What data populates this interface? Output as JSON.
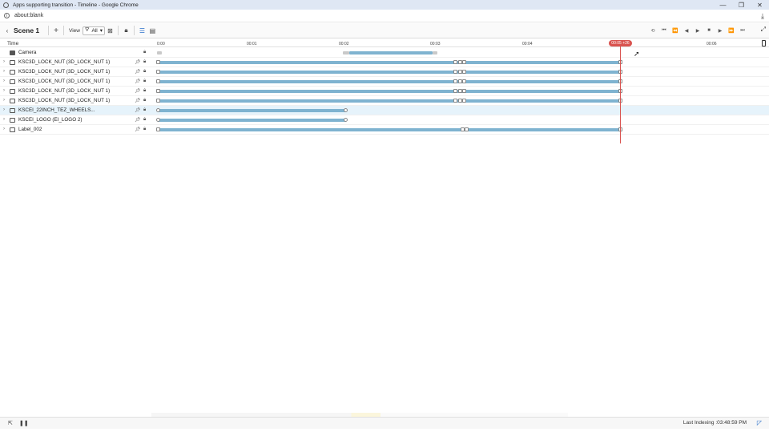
{
  "window": {
    "title": "Apps supporting transition - Timeline - Google Chrome",
    "controls": [
      "—",
      "❐",
      "✕"
    ]
  },
  "addressbar": {
    "url": "about:blank"
  },
  "toolbar": {
    "scene_title": "Scene 1",
    "view_label": "View",
    "filter_value": "All"
  },
  "timeline": {
    "header_label": "Time",
    "ticks": [
      "0:00",
      "00:01",
      "00:02",
      "00:03",
      "00:04",
      "00:06"
    ],
    "playhead_time": "00:05 +26"
  },
  "tracks": [
    {
      "name": "Camera",
      "icon": "camera-icon",
      "pinned": false
    },
    {
      "name": "KSC3D_LOCK_NUT (3D_LOCK_NUT 1)",
      "icon": "object-3d-icon",
      "pinned": true
    },
    {
      "name": "KSC3D_LOCK_NUT (3D_LOCK_NUT 1)",
      "icon": "object-3d-icon",
      "pinned": true
    },
    {
      "name": "KSC3D_LOCK_NUT (3D_LOCK_NUT 1)",
      "icon": "object-3d-icon",
      "pinned": true
    },
    {
      "name": "KSC3D_LOCK_NUT (3D_LOCK_NUT 1)",
      "icon": "object-3d-icon",
      "pinned": true
    },
    {
      "name": "KSC3D_LOCK_NUT (3D_LOCK_NUT 1)",
      "icon": "object-3d-icon",
      "pinned": true
    },
    {
      "name": "KSCEI_22INCH_TEZ_WHEELS...",
      "icon": "object-3d-icon",
      "pinned": true,
      "selected": true
    },
    {
      "name": "KSCEI_LOGO (EI_LOGO 2)",
      "icon": "object-3d-icon",
      "pinned": true
    },
    {
      "name": "Label_002",
      "icon": "label-icon",
      "pinned": true
    }
  ],
  "status": {
    "indexing": "Last Indexing :03:48:59 PM"
  },
  "colors": {
    "accent": "#2a6fc9",
    "bar": "#7fb3d0",
    "playhead": "#d9534f",
    "selected_row": "#e6f3fb"
  }
}
